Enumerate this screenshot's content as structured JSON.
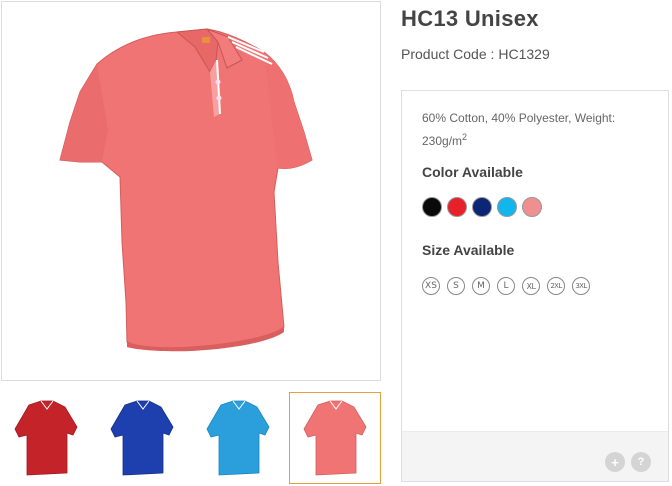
{
  "product": {
    "title": "HC13 Unisex",
    "code_label": "Product Code :",
    "code_value": "HC1329",
    "desc_main": "60% Cotton, 40% Polyester, Weight: 230g/m",
    "desc_sup": "2"
  },
  "colors": {
    "label": "Color Available",
    "swatches": [
      {
        "name": "black",
        "hex": "#0a0a0a"
      },
      {
        "name": "red",
        "hex": "#e8202a"
      },
      {
        "name": "navy",
        "hex": "#0c2575"
      },
      {
        "name": "sky-blue",
        "hex": "#12b5ec"
      },
      {
        "name": "salmon-pink",
        "hex": "#f08f8f"
      }
    ]
  },
  "sizes": {
    "label": "Size Available",
    "items": [
      "XS",
      "S",
      "M",
      "L",
      "XL",
      "2XL",
      "3XL"
    ]
  },
  "images": {
    "main_color": "#f17474",
    "thumbnails": [
      {
        "color": "#c4232a"
      },
      {
        "color": "#1e3fae"
      },
      {
        "color": "#2a9fdb"
      },
      {
        "color": "#f17474"
      }
    ],
    "active_thumbnail": 3
  },
  "footer": {
    "zoom_icon": "plus-icon",
    "help_icon": "question-icon",
    "zoom_label": "+",
    "help_label": "?"
  }
}
